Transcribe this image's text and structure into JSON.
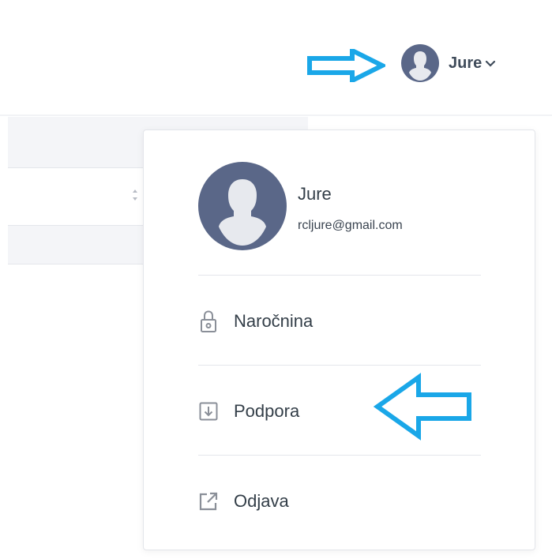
{
  "header": {
    "user_name": "Jure",
    "user_avatar_icon": "user-avatar-icon",
    "dropdown_icon": "chevron-down-icon"
  },
  "user_menu": {
    "profile": {
      "name": "Jure",
      "email": "rcljure@gmail.com"
    },
    "items": [
      {
        "label": "Naročnina",
        "icon": "lock-icon"
      },
      {
        "label": "Podpora",
        "icon": "download-icon"
      },
      {
        "label": "Odjava",
        "icon": "external-link-icon"
      }
    ]
  },
  "annotations": {
    "arrow_color": "#1aa7e8"
  },
  "colors": {
    "avatar_bg": "#5a6788",
    "avatar_silhouette": "#e7e9ee",
    "text": "#333e48",
    "icon": "#8a8f98"
  }
}
